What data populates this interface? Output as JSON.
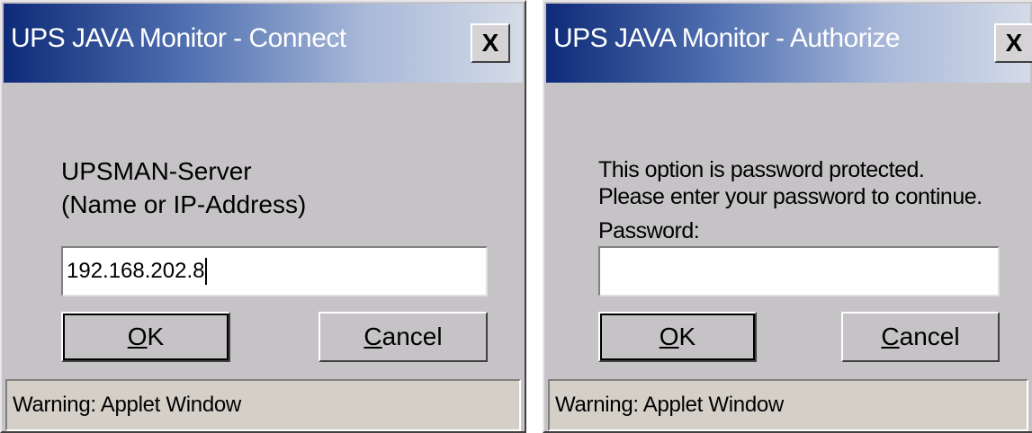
{
  "connect_dialog": {
    "title": "UPS JAVA Monitor - Connect",
    "close_label": "X",
    "server_label_line1": "UPSMAN-Server",
    "server_label_line2": "(Name or IP-Address)",
    "server_value": "192.168.202.8",
    "ok_label_mnemonic": "O",
    "ok_label_rest": "K",
    "cancel_label_mnemonic": "C",
    "cancel_label_rest": "ancel",
    "status": "Warning: Applet Window"
  },
  "authorize_dialog": {
    "title": "UPS JAVA Monitor - Authorize",
    "close_label": "X",
    "message_line1": "This option is password protected.",
    "message_line2": "Please enter your password to continue.",
    "password_label": "Password:",
    "password_value": "",
    "ok_label_mnemonic": "O",
    "ok_label_rest": "K",
    "cancel_label_mnemonic": "C",
    "cancel_label_rest": "ancel",
    "status": "Warning: Applet Window"
  }
}
